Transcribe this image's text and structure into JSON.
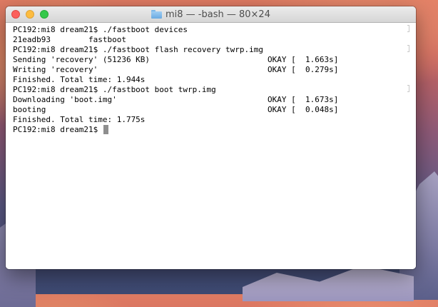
{
  "window": {
    "title": "mi8 — -bash — 80×24",
    "folder_icon": "folder-icon"
  },
  "terminal": {
    "lines": [
      {
        "a": "PC192:mi8 dream21$ ./fastboot devices",
        "b": ""
      },
      {
        "a": "21eadb93        fastboot",
        "b": ""
      },
      {
        "a": "PC192:mi8 dream21$ ./fastboot flash recovery twrp.img",
        "b": ""
      },
      {
        "a": "Sending 'recovery' (51236 KB)",
        "b": "OKAY [  1.663s]"
      },
      {
        "a": "Writing 'recovery'",
        "b": "OKAY [  0.279s]"
      },
      {
        "a": "Finished. Total time: 1.944s",
        "b": ""
      },
      {
        "a": "PC192:mi8 dream21$ ./fastboot boot twrp.img",
        "b": ""
      },
      {
        "a": "Downloading 'boot.img'",
        "b": "OKAY [  1.673s]"
      },
      {
        "a": "booting",
        "b": "OKAY [  0.048s]"
      },
      {
        "a": "Finished. Total time: 1.775s",
        "b": ""
      },
      {
        "a": "PC192:mi8 dream21$ ",
        "b": ""
      }
    ]
  }
}
